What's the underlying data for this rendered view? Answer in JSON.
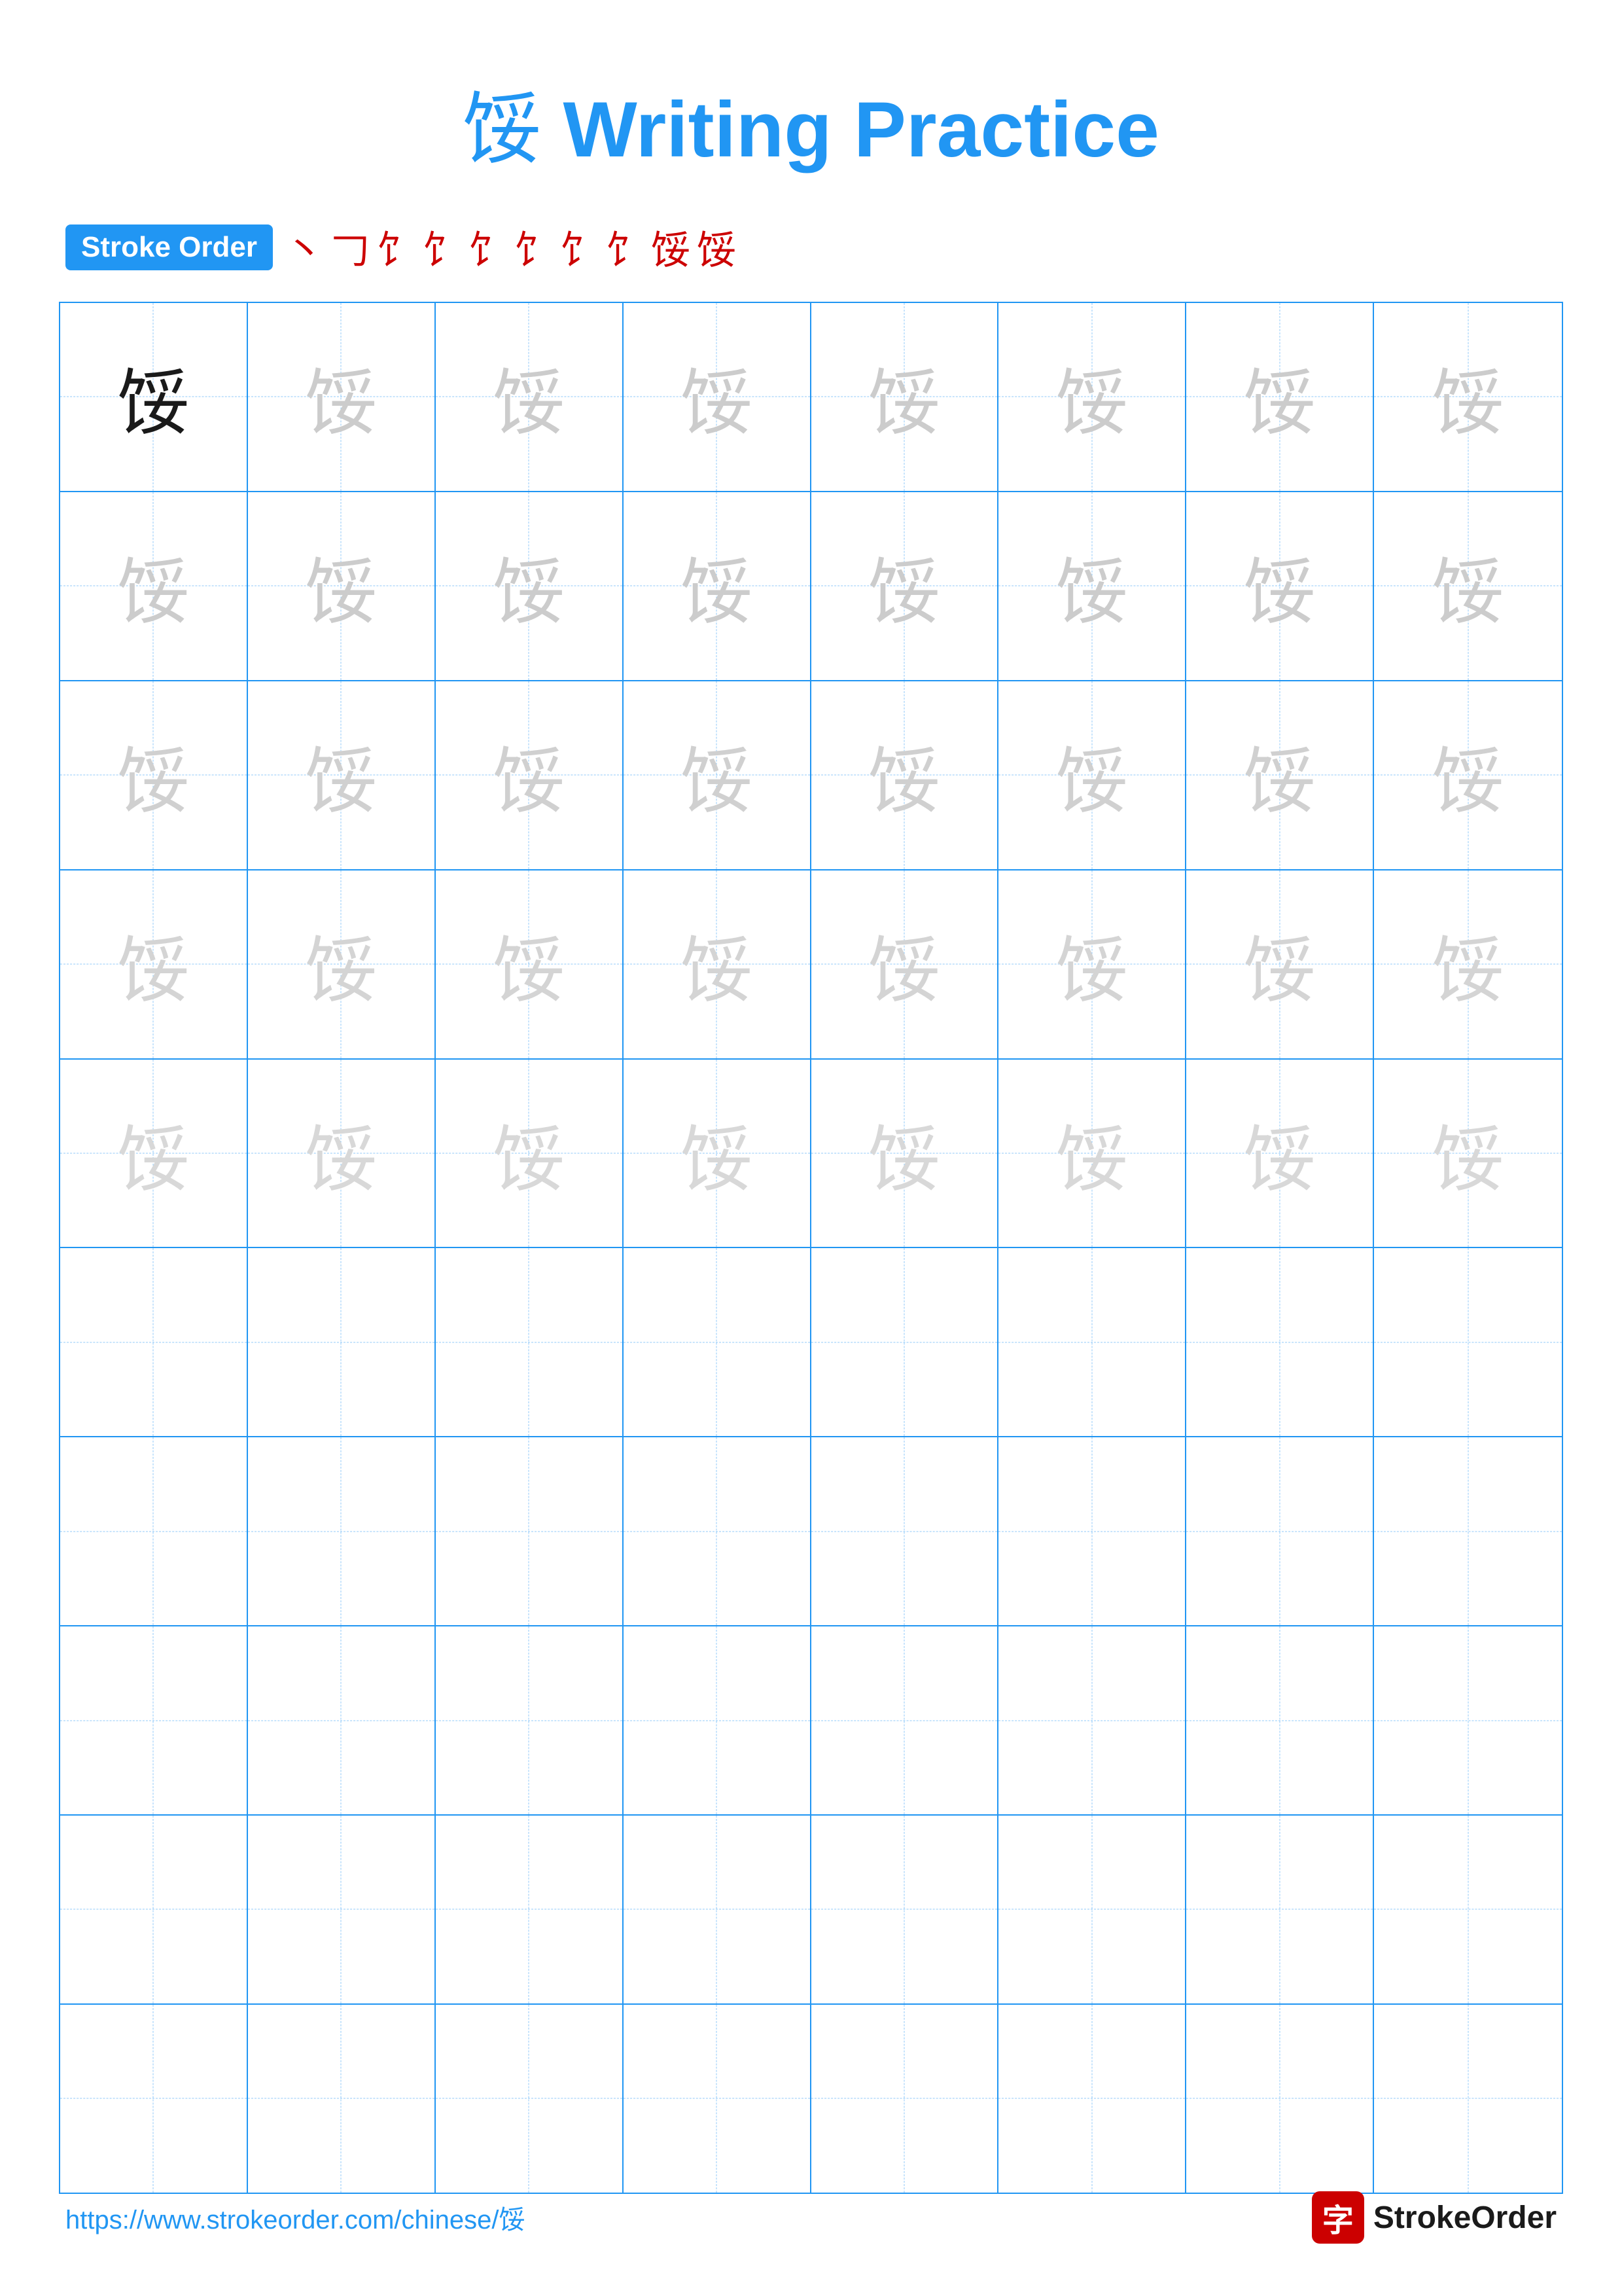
{
  "title": {
    "char": "馁",
    "text": " Writing Practice"
  },
  "stroke_order": {
    "badge_label": "Stroke Order",
    "strokes": [
      "丶",
      "𠃌",
      "饣",
      "饣",
      "饣饣",
      "饣饣",
      "饣饣饣",
      "饣饣饣饣",
      "饣饣饣饣饣",
      "馁"
    ]
  },
  "character": "馁",
  "rows": {
    "practice_rows": 5,
    "empty_rows": 5,
    "cols": 8
  },
  "footer": {
    "url": "https://www.strokeorder.com/chinese/馁",
    "logo_char": "字",
    "logo_text": "StrokeOrder"
  }
}
